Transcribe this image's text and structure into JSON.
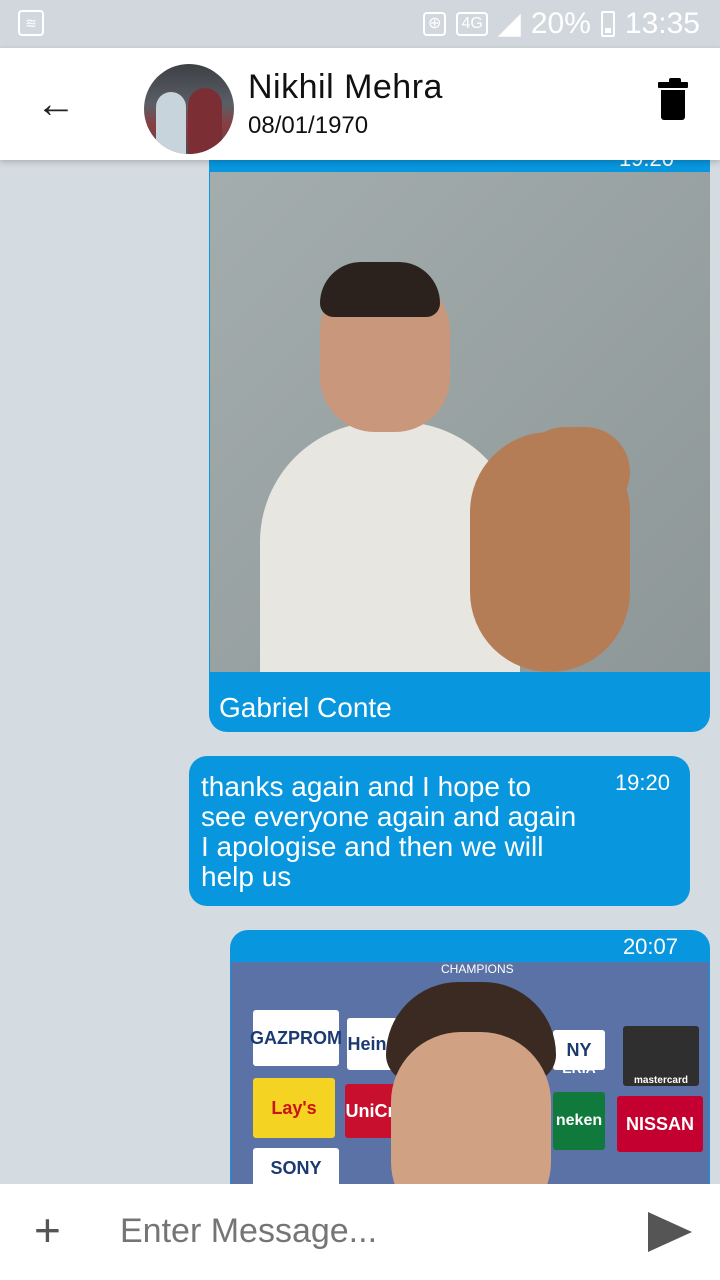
{
  "status": {
    "battery": "20%",
    "time": "13:35",
    "network": "4G"
  },
  "header": {
    "name": "Nikhil Mehra",
    "date": "08/01/1970"
  },
  "messages": [
    {
      "type": "image",
      "time": "19:20",
      "caption": "Gabriel Conte"
    },
    {
      "type": "text",
      "time": "19:20",
      "text": "thanks again and I hope to see everyone again and again I apologise and then we will help us"
    },
    {
      "type": "image",
      "time": "20:07"
    }
  ],
  "photo2": {
    "banner": "CHAMPIONS",
    "sponsors": [
      "GAZPROM",
      "Heine",
      "Lay's",
      "UniCre",
      "SONY",
      "NY",
      "ERIA",
      "mastercard",
      "neken",
      "NISSAN"
    ]
  },
  "input": {
    "placeholder": "Enter Message..."
  },
  "colors": {
    "bubble": "#0896de",
    "background": "#d4dbe1"
  }
}
